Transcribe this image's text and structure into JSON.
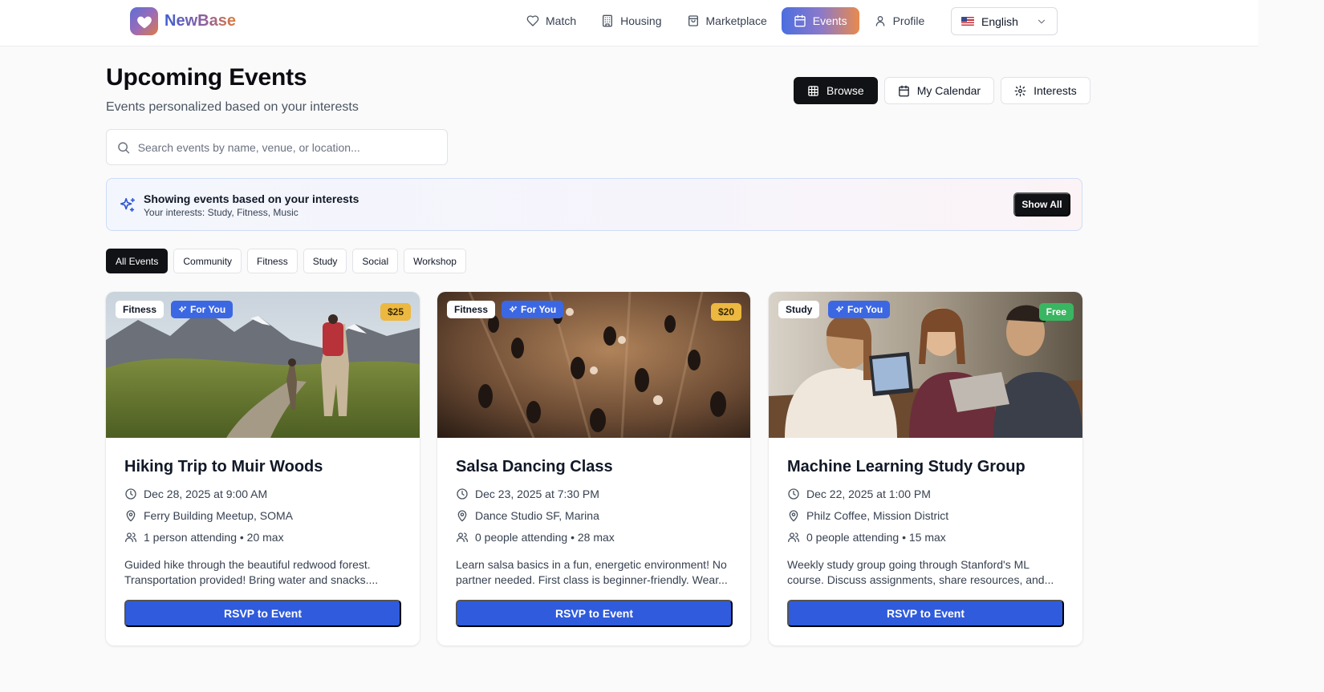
{
  "brand": {
    "name": "NewBase"
  },
  "nav": {
    "items": [
      {
        "label": "Match",
        "icon": "heart-icon"
      },
      {
        "label": "Housing",
        "icon": "building-icon"
      },
      {
        "label": "Marketplace",
        "icon": "shopping-bag-icon"
      },
      {
        "label": "Events",
        "icon": "calendar-icon",
        "active": true
      },
      {
        "label": "Profile",
        "icon": "user-icon"
      }
    ],
    "language": "English"
  },
  "header": {
    "title": "Upcoming Events",
    "subtitle": "Events personalized based on your interests",
    "views": [
      {
        "label": "Browse",
        "icon": "grid-icon",
        "active": true
      },
      {
        "label": "My Calendar",
        "icon": "calendar-icon"
      },
      {
        "label": "Interests",
        "icon": "gear-icon"
      }
    ]
  },
  "search": {
    "placeholder": "Search events by name, venue, or location...",
    "value": ""
  },
  "banner": {
    "title": "Showing events based on your interests",
    "subtitle": "Your interests: Study, Fitness, Music",
    "button": "Show All"
  },
  "filters": [
    "All Events",
    "Community",
    "Fitness",
    "Study",
    "Social",
    "Workshop"
  ],
  "active_filter": "All Events",
  "events": [
    {
      "category": "Fitness",
      "badge": "For You",
      "price": "$25",
      "title": "Hiking Trip to Muir Woods",
      "datetime": "Dec 28, 2025 at 9:00 AM",
      "location": "Ferry Building Meetup, SOMA",
      "attendance": "1 person attending • 20 max",
      "description": "Guided hike through the beautiful redwood forest. Transportation provided! Bring water and snacks....",
      "cta": "RSVP to Event"
    },
    {
      "category": "Fitness",
      "badge": "For You",
      "price": "$20",
      "title": "Salsa Dancing Class",
      "datetime": "Dec 23, 2025 at 7:30 PM",
      "location": "Dance Studio SF, Marina",
      "attendance": "0 people attending • 28 max",
      "description": "Learn salsa basics in a fun, energetic environment! No partner needed. First class is beginner-friendly. Wear...",
      "cta": "RSVP to Event"
    },
    {
      "category": "Study",
      "badge": "For You",
      "price": "Free",
      "title": "Machine Learning Study Group",
      "datetime": "Dec 22, 2025 at 1:00 PM",
      "location": "Philz Coffee, Mission District",
      "attendance": "0 people attending • 15 max",
      "description": "Weekly study group going through Stanford's ML course. Discuss assignments, share resources, and...",
      "cta": "RSVP to Event"
    }
  ],
  "colors": {
    "primary": "#2f5bdc",
    "dark": "#111216",
    "for_you_badge": "#3c67e3",
    "price_paid": "#ecb840",
    "price_free": "#3ab561"
  }
}
